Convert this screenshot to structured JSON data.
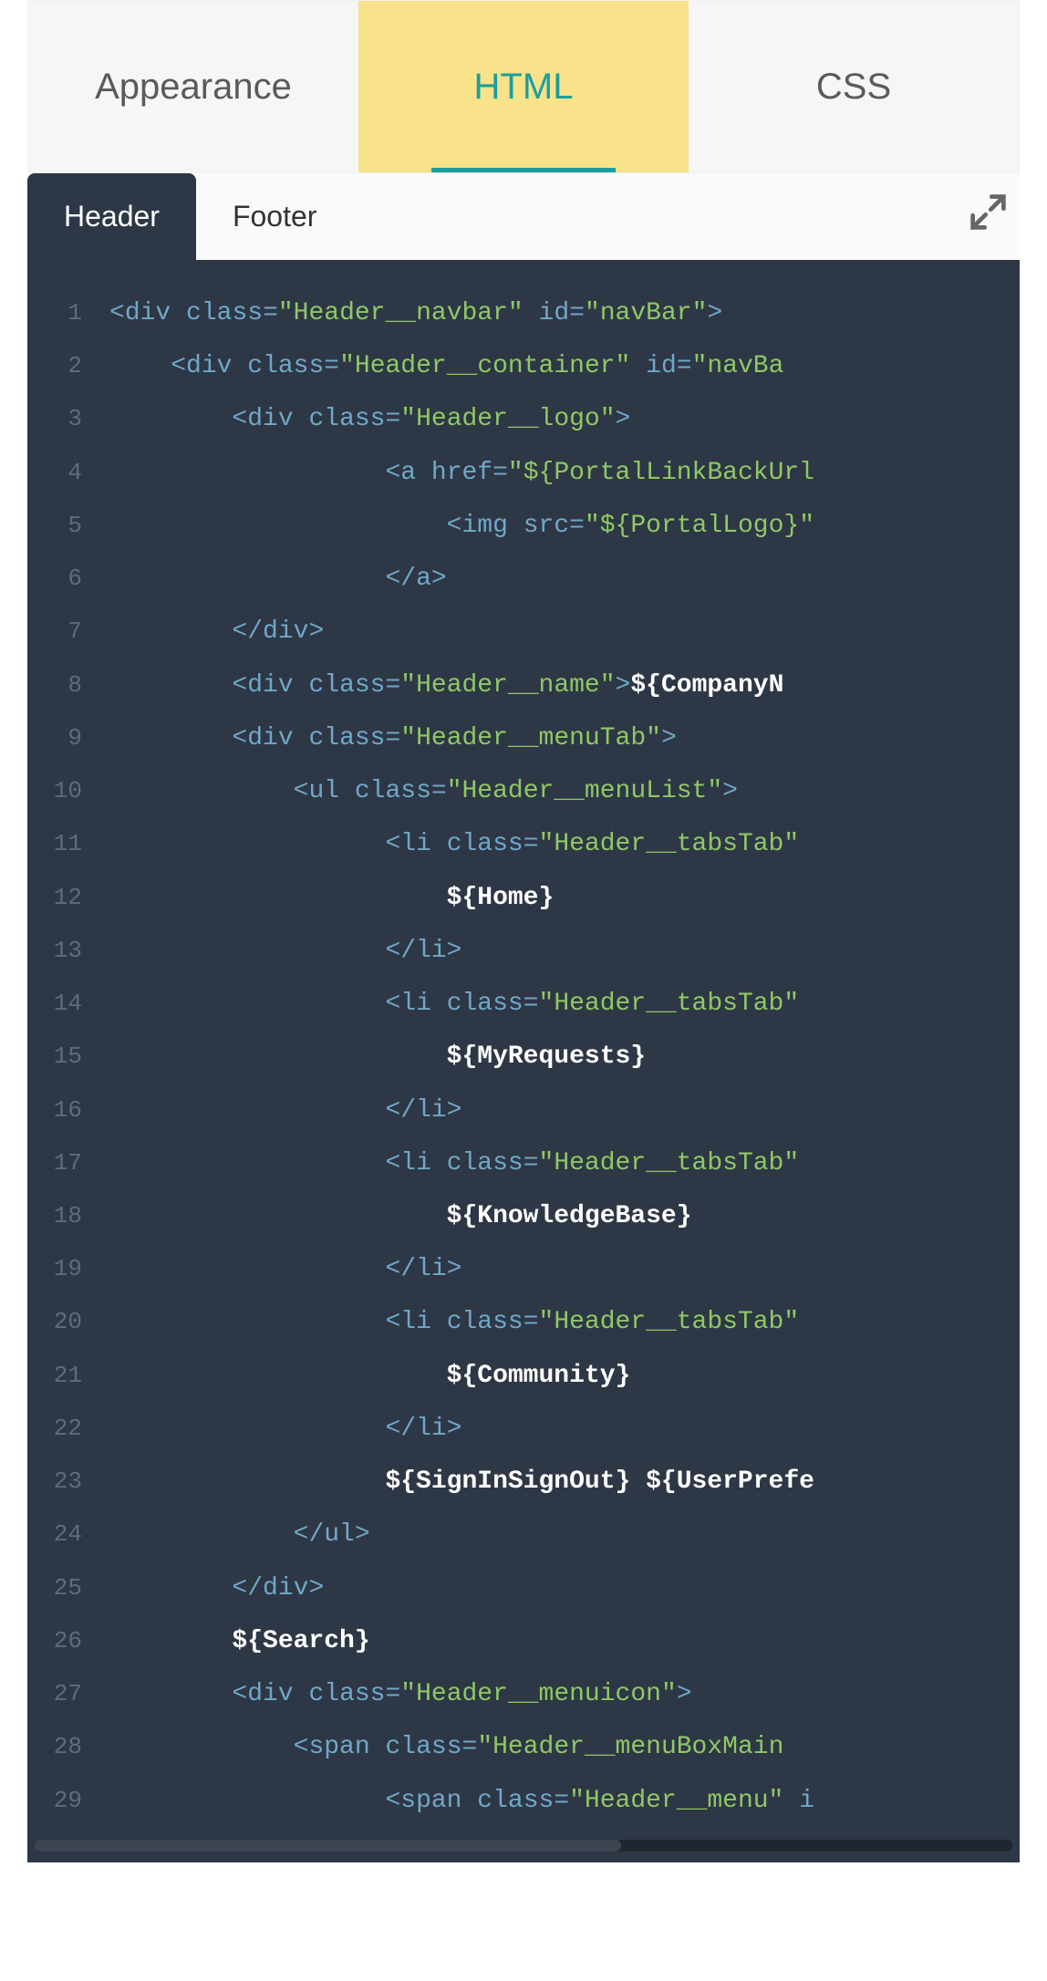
{
  "top_tabs": {
    "appearance": "Appearance",
    "html": "HTML",
    "css": "CSS",
    "active": "html"
  },
  "sub_tabs": {
    "header": "Header",
    "footer": "Footer",
    "active": "header"
  },
  "code": {
    "lines": [
      {
        "n": "1",
        "indent": 0,
        "tokens": [
          [
            "punct",
            "<"
          ],
          [
            "tag",
            "div"
          ],
          [
            "text",
            " "
          ],
          [
            "attr",
            "class"
          ],
          [
            "eq",
            "="
          ],
          [
            "str",
            "\"Header__navbar\""
          ],
          [
            "text",
            " "
          ],
          [
            "attr",
            "id"
          ],
          [
            "eq",
            "="
          ],
          [
            "str",
            "\"navBar\""
          ],
          [
            "punct",
            ">"
          ]
        ]
      },
      {
        "n": "2",
        "indent": 4,
        "tokens": [
          [
            "punct",
            "<"
          ],
          [
            "tag",
            "div"
          ],
          [
            "text",
            " "
          ],
          [
            "attr",
            "class"
          ],
          [
            "eq",
            "="
          ],
          [
            "str",
            "\"Header__container\""
          ],
          [
            "text",
            " "
          ],
          [
            "attr",
            "id"
          ],
          [
            "eq",
            "="
          ],
          [
            "str",
            "\"navBa"
          ]
        ]
      },
      {
        "n": "3",
        "indent": 8,
        "tokens": [
          [
            "punct",
            "<"
          ],
          [
            "tag",
            "div"
          ],
          [
            "text",
            " "
          ],
          [
            "attr",
            "class"
          ],
          [
            "eq",
            "="
          ],
          [
            "str",
            "\"Header__logo\""
          ],
          [
            "punct",
            ">"
          ]
        ]
      },
      {
        "n": "4",
        "indent": 18,
        "tokens": [
          [
            "punct",
            "<"
          ],
          [
            "tag",
            "a"
          ],
          [
            "text",
            " "
          ],
          [
            "attr",
            "href"
          ],
          [
            "eq",
            "="
          ],
          [
            "str",
            "\"${PortalLinkBackUrl"
          ]
        ]
      },
      {
        "n": "5",
        "indent": 22,
        "tokens": [
          [
            "punct",
            "<"
          ],
          [
            "tag",
            "img"
          ],
          [
            "text",
            " "
          ],
          [
            "attr",
            "src"
          ],
          [
            "eq",
            "="
          ],
          [
            "str",
            "\"${PortalLogo}\""
          ]
        ]
      },
      {
        "n": "6",
        "indent": 18,
        "tokens": [
          [
            "punct",
            "</"
          ],
          [
            "tag",
            "a"
          ],
          [
            "punct",
            ">"
          ]
        ]
      },
      {
        "n": "7",
        "indent": 8,
        "tokens": [
          [
            "punct",
            "</"
          ],
          [
            "tag",
            "div"
          ],
          [
            "punct",
            ">"
          ]
        ]
      },
      {
        "n": "8",
        "indent": 8,
        "tokens": [
          [
            "punct",
            "<"
          ],
          [
            "tag",
            "div"
          ],
          [
            "text",
            " "
          ],
          [
            "attr",
            "class"
          ],
          [
            "eq",
            "="
          ],
          [
            "str",
            "\"Header__name\""
          ],
          [
            "punct",
            ">"
          ],
          [
            "var",
            "${CompanyN"
          ]
        ]
      },
      {
        "n": "9",
        "indent": 8,
        "tokens": [
          [
            "punct",
            "<"
          ],
          [
            "tag",
            "div"
          ],
          [
            "text",
            " "
          ],
          [
            "attr",
            "class"
          ],
          [
            "eq",
            "="
          ],
          [
            "str",
            "\"Header__menuTab\""
          ],
          [
            "punct",
            ">"
          ]
        ]
      },
      {
        "n": "10",
        "indent": 12,
        "tokens": [
          [
            "punct",
            "<"
          ],
          [
            "tag",
            "ul"
          ],
          [
            "text",
            " "
          ],
          [
            "attr",
            "class"
          ],
          [
            "eq",
            "="
          ],
          [
            "str",
            "\"Header__menuList\""
          ],
          [
            "punct",
            ">"
          ]
        ]
      },
      {
        "n": "11",
        "indent": 18,
        "tokens": [
          [
            "punct",
            "<"
          ],
          [
            "tag",
            "li"
          ],
          [
            "text",
            " "
          ],
          [
            "attr",
            "class"
          ],
          [
            "eq",
            "="
          ],
          [
            "str",
            "\"Header__tabsTab\""
          ]
        ]
      },
      {
        "n": "12",
        "indent": 22,
        "tokens": [
          [
            "var",
            "${Home}"
          ]
        ]
      },
      {
        "n": "13",
        "indent": 18,
        "tokens": [
          [
            "punct",
            "</"
          ],
          [
            "tag",
            "li"
          ],
          [
            "punct",
            ">"
          ]
        ]
      },
      {
        "n": "14",
        "indent": 18,
        "tokens": [
          [
            "punct",
            "<"
          ],
          [
            "tag",
            "li"
          ],
          [
            "text",
            " "
          ],
          [
            "attr",
            "class"
          ],
          [
            "eq",
            "="
          ],
          [
            "str",
            "\"Header__tabsTab\""
          ]
        ]
      },
      {
        "n": "15",
        "indent": 22,
        "tokens": [
          [
            "var",
            "${MyRequests}"
          ]
        ]
      },
      {
        "n": "16",
        "indent": 18,
        "tokens": [
          [
            "punct",
            "</"
          ],
          [
            "tag",
            "li"
          ],
          [
            "punct",
            ">"
          ]
        ]
      },
      {
        "n": "17",
        "indent": 18,
        "tokens": [
          [
            "punct",
            "<"
          ],
          [
            "tag",
            "li"
          ],
          [
            "text",
            " "
          ],
          [
            "attr",
            "class"
          ],
          [
            "eq",
            "="
          ],
          [
            "str",
            "\"Header__tabsTab\""
          ]
        ]
      },
      {
        "n": "18",
        "indent": 22,
        "tokens": [
          [
            "var",
            "${KnowledgeBase}"
          ]
        ]
      },
      {
        "n": "19",
        "indent": 18,
        "tokens": [
          [
            "punct",
            "</"
          ],
          [
            "tag",
            "li"
          ],
          [
            "punct",
            ">"
          ]
        ]
      },
      {
        "n": "20",
        "indent": 18,
        "tokens": [
          [
            "punct",
            "<"
          ],
          [
            "tag",
            "li"
          ],
          [
            "text",
            " "
          ],
          [
            "attr",
            "class"
          ],
          [
            "eq",
            "="
          ],
          [
            "str",
            "\"Header__tabsTab\""
          ]
        ]
      },
      {
        "n": "21",
        "indent": 22,
        "tokens": [
          [
            "var",
            "${Community}"
          ]
        ]
      },
      {
        "n": "22",
        "indent": 18,
        "tokens": [
          [
            "punct",
            "</"
          ],
          [
            "tag",
            "li"
          ],
          [
            "punct",
            ">"
          ]
        ]
      },
      {
        "n": "23",
        "indent": 18,
        "tokens": [
          [
            "var",
            "${SignInSignOut} ${UserPrefe"
          ]
        ]
      },
      {
        "n": "24",
        "indent": 12,
        "tokens": [
          [
            "punct",
            "</"
          ],
          [
            "tag",
            "ul"
          ],
          [
            "punct",
            ">"
          ]
        ]
      },
      {
        "n": "25",
        "indent": 8,
        "tokens": [
          [
            "punct",
            "</"
          ],
          [
            "tag",
            "div"
          ],
          [
            "punct",
            ">"
          ]
        ]
      },
      {
        "n": "26",
        "indent": 8,
        "tokens": [
          [
            "var",
            "${Search}"
          ]
        ]
      },
      {
        "n": "27",
        "indent": 8,
        "tokens": [
          [
            "punct",
            "<"
          ],
          [
            "tag",
            "div"
          ],
          [
            "text",
            " "
          ],
          [
            "attr",
            "class"
          ],
          [
            "eq",
            "="
          ],
          [
            "str",
            "\"Header__menuicon\""
          ],
          [
            "punct",
            ">"
          ]
        ]
      },
      {
        "n": "28",
        "indent": 12,
        "tokens": [
          [
            "punct",
            "<"
          ],
          [
            "tag",
            "span"
          ],
          [
            "text",
            " "
          ],
          [
            "attr",
            "class"
          ],
          [
            "eq",
            "="
          ],
          [
            "str",
            "\"Header__menuBoxMain"
          ]
        ]
      },
      {
        "n": "29",
        "indent": 18,
        "tokens": [
          [
            "punct",
            "<"
          ],
          [
            "tag",
            "span"
          ],
          [
            "text",
            " "
          ],
          [
            "attr",
            "class"
          ],
          [
            "eq",
            "="
          ],
          [
            "str",
            "\"Header__menu\""
          ],
          [
            "text",
            " "
          ],
          [
            "attr",
            "i"
          ]
        ]
      }
    ]
  }
}
